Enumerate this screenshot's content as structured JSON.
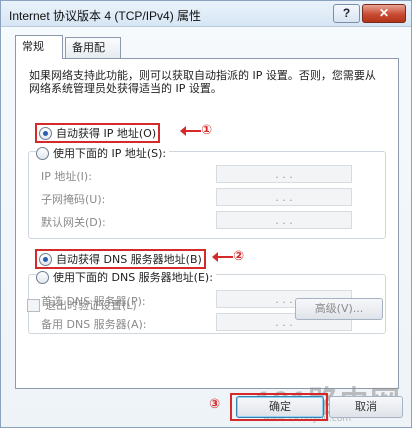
{
  "window": {
    "title": "Internet 协议版本 4 (TCP/IPv4) 属性",
    "help_label": "?",
    "close_label": "✕"
  },
  "tabs": [
    {
      "label": "常规"
    },
    {
      "label": "备用配置"
    }
  ],
  "description": "如果网络支持此功能，则可以获取自动指派的 IP 设置。否则，您需要从网络系统管理员处获得适当的 IP 设置。",
  "ip_section": {
    "auto_label": "自动获得 IP 地址(O)",
    "manual_label": "使用下面的 IP 地址(S):",
    "fields": [
      {
        "label": "IP 地址(I):",
        "value": ".   .   ."
      },
      {
        "label": "子网掩码(U):",
        "value": ".   .   ."
      },
      {
        "label": "默认网关(D):",
        "value": ".   .   ."
      }
    ]
  },
  "dns_section": {
    "auto_label": "自动获得 DNS 服务器地址(B)",
    "manual_label": "使用下面的 DNS 服务器地址(E):",
    "fields": [
      {
        "label": "首选 DNS 服务器(P):",
        "value": ".   .   ."
      },
      {
        "label": "备用 DNS 服务器(A):",
        "value": ".   .   ."
      }
    ]
  },
  "validate_on_exit_label": "退出时验证设置(L)",
  "advanced_label": "高级(V)...",
  "ok_label": "确定",
  "cancel_label": "取消",
  "annotations": [
    "①",
    "②",
    "③"
  ],
  "watermark": "191路由网",
  "watermark_url": "www.191luyou.com",
  "colors": {
    "annotation": "#d42a2a",
    "accent": "#2a5fb0"
  }
}
